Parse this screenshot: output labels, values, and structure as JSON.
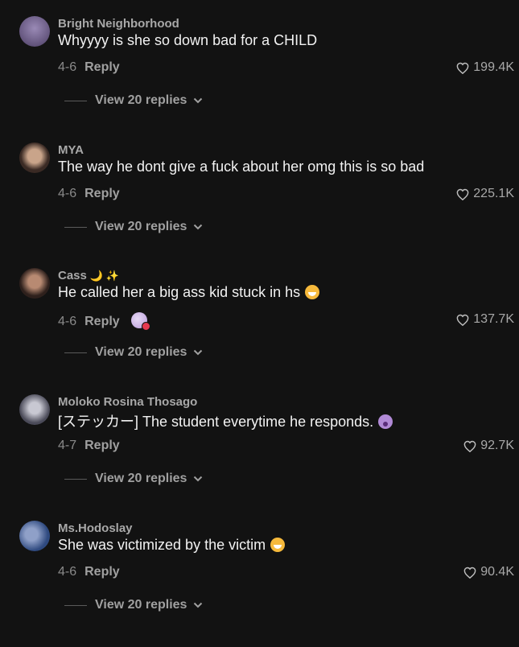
{
  "comments": [
    {
      "username": "Bright Neighborhood",
      "text": "Whyyyy is she so down bad for a CHILD",
      "date": "4-6",
      "reply_label": "Reply",
      "likes": "199.4K",
      "view_replies": "View 20 replies"
    },
    {
      "username": "MYA",
      "text": "The way he dont give a fuck about her omg this is so bad",
      "date": "4-6",
      "reply_label": "Reply",
      "likes": "225.1K",
      "view_replies": "View 20 replies"
    },
    {
      "username": "Cass",
      "username_emoji": "🌙 ✨",
      "text": "He called her a big ass kid stuck in hs",
      "date": "4-6",
      "reply_label": "Reply",
      "likes": "137.7K",
      "view_replies": "View 20 replies"
    },
    {
      "username": "Moloko Rosina Thosago",
      "text": "[ステッカー] The student everytime he responds.",
      "date": "4-7",
      "reply_label": "Reply",
      "likes": "92.7K",
      "view_replies": "View 20 replies"
    },
    {
      "username": "Ms.Hodoslay",
      "text": "She was victimized by the victim",
      "date": "4-6",
      "reply_label": "Reply",
      "likes": "90.4K",
      "view_replies": "View 20 replies"
    }
  ],
  "avatars": [
    {
      "icon": "avatar-photo",
      "color": "#6b5a86"
    },
    {
      "icon": "avatar-photo",
      "color": "#5a4a42"
    },
    {
      "icon": "avatar-photo",
      "color": "#4a3a34"
    },
    {
      "icon": "avatar-photo",
      "color": "#7a7a86"
    },
    {
      "icon": "avatar-photo",
      "color": "#3f5f8f"
    }
  ]
}
